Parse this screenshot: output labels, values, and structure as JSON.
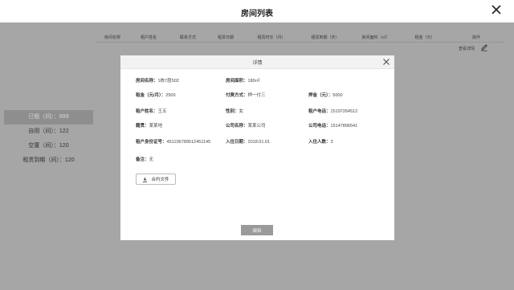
{
  "header": {
    "title": "房间列表"
  },
  "table": {
    "columns": [
      "房间名称",
      "租户姓名",
      "联系方式",
      "租赁日期",
      "租赁时长（月）",
      "租赁到期（天）",
      "房间面积（㎡）",
      "租金（元）",
      "操作"
    ],
    "row_action": "查看详情"
  },
  "stats": [
    {
      "label": "已租（间）：899",
      "active": true
    },
    {
      "label": "自用（间）：122",
      "active": false
    },
    {
      "label": "空置（间）：120",
      "active": false
    },
    {
      "label": "租赁到期（间）：120",
      "active": false
    }
  ],
  "modal": {
    "title": "详情",
    "fields": {
      "room_name": {
        "label": "房间名称：",
        "value": "1栋7层502"
      },
      "room_area": {
        "label": "房间面积：",
        "value": "180㎡"
      },
      "rent": {
        "label": "租金（元/月）：",
        "value": "2500"
      },
      "payment": {
        "label": "付费方式：",
        "value": "押一付三"
      },
      "deposit": {
        "label": "押金（元）：",
        "value": "5000"
      },
      "tenant_name": {
        "label": "租户姓名：",
        "value": "王五"
      },
      "gender": {
        "label": "性别：",
        "value": "女"
      },
      "tenant_phone": {
        "label": "租户电话：",
        "value": "15197264512"
      },
      "origin": {
        "label": "籍贯：",
        "value": "某某地"
      },
      "company_name": {
        "label": "公司名称：",
        "value": "某某公司"
      },
      "company_phone": {
        "label": "公司电话：",
        "value": "15147896541"
      },
      "id_number": {
        "label": "租户身份证号：",
        "value": "451236789512451145"
      },
      "checkin_date": {
        "label": "入住日期：",
        "value": "2018.01.01"
      },
      "occupants": {
        "label": "入住人数：",
        "value": "3"
      },
      "note": {
        "label": "备注：",
        "value": "无"
      }
    },
    "contract_button": "合约文件",
    "edit_button": "编辑"
  },
  "colors": {
    "overlay": "#a6a6a6",
    "active_stat": "#8e8e8e",
    "edit_button": "#9a9a9a",
    "modal_header": "#f2f2f2"
  },
  "icons": [
    "close-icon",
    "edit-pencil-icon",
    "download-icon"
  ]
}
